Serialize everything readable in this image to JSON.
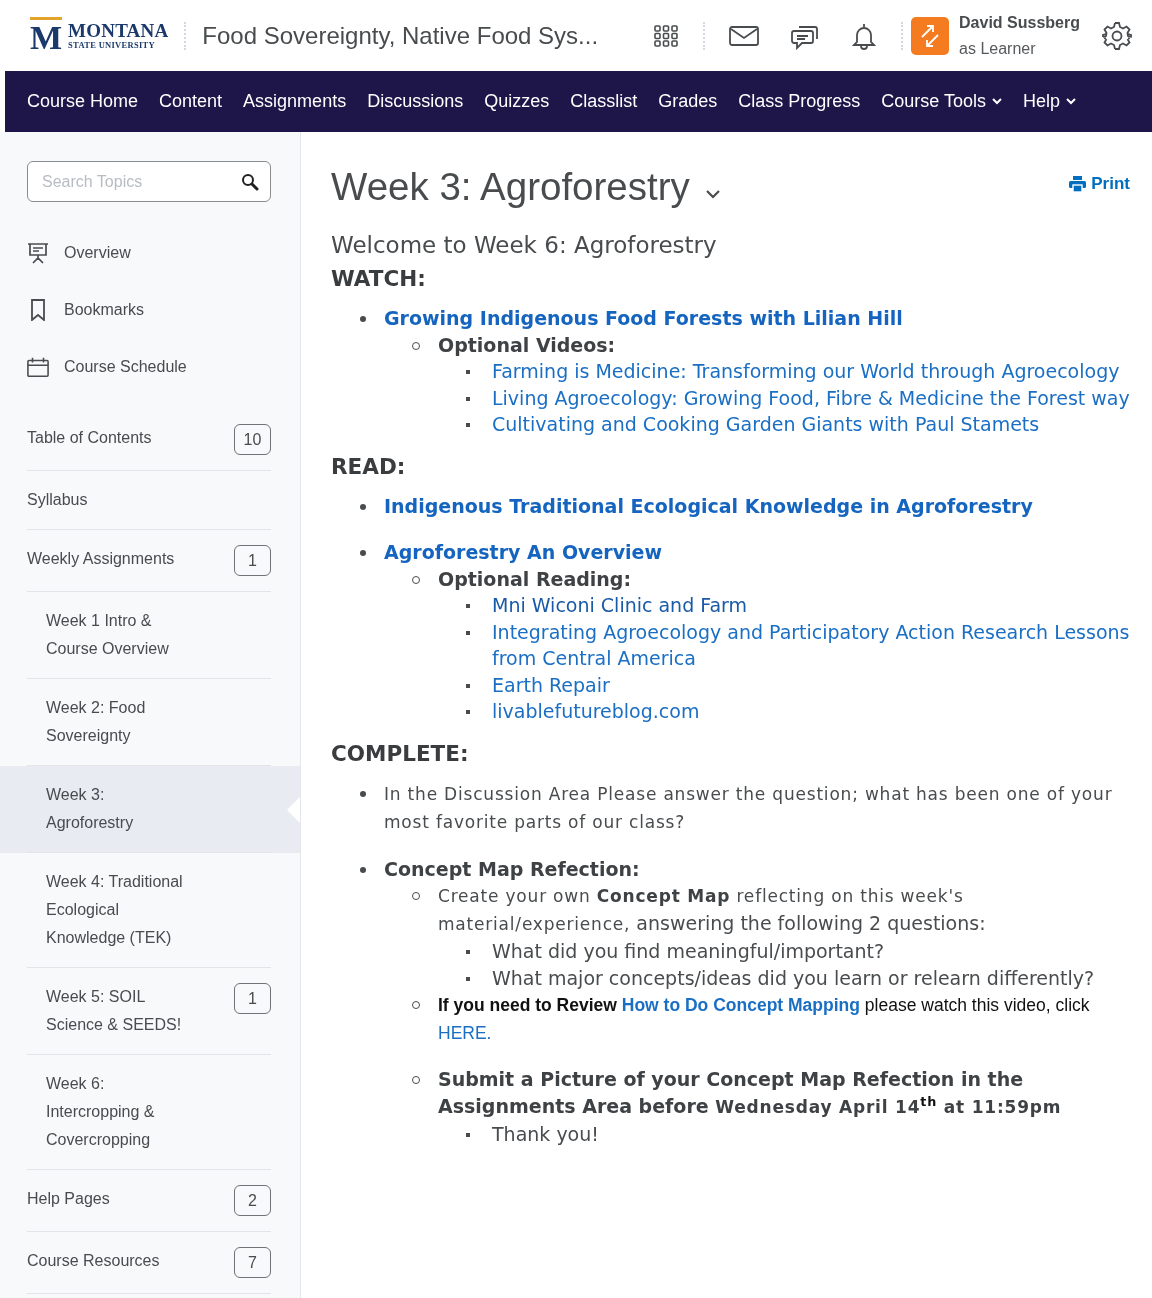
{
  "header": {
    "logo": {
      "mark": "M",
      "name": "MONTANA",
      "subtitle": "STATE UNIVERSITY"
    },
    "course_title": "Food Sovereignty, Native Food Sys...",
    "user": {
      "name": "David Sussberg",
      "role": "as Learner"
    }
  },
  "nav": {
    "items": [
      {
        "label": "Course Home",
        "dropdown": false
      },
      {
        "label": "Content",
        "dropdown": false
      },
      {
        "label": "Assignments",
        "dropdown": false
      },
      {
        "label": "Discussions",
        "dropdown": false
      },
      {
        "label": "Quizzes",
        "dropdown": false
      },
      {
        "label": "Classlist",
        "dropdown": false
      },
      {
        "label": "Grades",
        "dropdown": false
      },
      {
        "label": "Class Progress",
        "dropdown": false
      },
      {
        "label": "Course Tools",
        "dropdown": true
      },
      {
        "label": "Help",
        "dropdown": true
      }
    ]
  },
  "sidebar": {
    "search": {
      "placeholder": "Search Topics"
    },
    "tools": [
      {
        "label": "Overview",
        "kind": "overview"
      },
      {
        "label": "Bookmarks",
        "kind": "bookmarks"
      },
      {
        "label": "Course Schedule",
        "kind": "schedule"
      }
    ],
    "items": [
      {
        "label": "Table of Contents",
        "count": "10",
        "selected": false
      },
      {
        "label": "Syllabus",
        "selected": false
      },
      {
        "label": "Weekly Assignments",
        "count": "1",
        "selected": false,
        "children": [
          {
            "label": "Week 1 Intro & Course Overview",
            "selected": false
          },
          {
            "label": "Week 2: Food Sovereignty",
            "selected": false
          },
          {
            "label": "Week 3: Agroforestry",
            "selected": true
          },
          {
            "label": "Week 4: Traditional Ecological Knowledge (TEK)",
            "selected": false
          },
          {
            "label": "Week 5: SOIL Science & SEEDS!",
            "count": "1",
            "selected": false
          },
          {
            "label": "Week 6: Intercropping & Covercropping",
            "selected": false
          }
        ]
      },
      {
        "label": "Help Pages",
        "count": "2",
        "selected": false
      },
      {
        "label": "Course Resources",
        "count": "7",
        "selected": false
      }
    ]
  },
  "content": {
    "title": "Week 3: Agroforestry",
    "print_label": "Print",
    "intro": "Welcome to Week 6: Agroforestry",
    "sections": [
      {
        "heading": "WATCH:",
        "items": [
          {
            "parts": [
              {
                "text": "Growing Indigenous Food Forests with Lilian Hill",
                "kind": "link-bold"
              }
            ],
            "children": [
              {
                "parts": [
                  {
                    "text": "Optional Videos:",
                    "kind": "bold"
                  }
                ],
                "children": [
                  {
                    "parts": [
                      {
                        "text": "Farming is Medicine: Transforming our World through Agroecology",
                        "kind": "link"
                      }
                    ]
                  },
                  {
                    "parts": [
                      {
                        "text": "Living Agroecology: Growing Food, Fibre & Medicine the Forest way",
                        "kind": "link"
                      }
                    ]
                  },
                  {
                    "parts": [
                      {
                        "text": "Cultivating and Cooking Garden Giants with Paul Stamets",
                        "kind": "link"
                      }
                    ]
                  }
                ]
              }
            ]
          }
        ]
      },
      {
        "heading": "READ:",
        "items": [
          {
            "parts": [
              {
                "text": "Indigenous Traditional Ecological Knowledge in Agroforestry",
                "kind": "link-bold"
              }
            ]
          },
          {
            "parts": [
              {
                "text": "Agroforestry An Overview",
                "kind": "link-bold"
              }
            ],
            "children": [
              {
                "parts": [
                  {
                    "text": "Optional Reading:",
                    "kind": "bold"
                  }
                ],
                "children": [
                  {
                    "parts": [
                      {
                        "text": "Mni Wiconi Clinic and Farm",
                        "kind": "link-dark"
                      }
                    ]
                  },
                  {
                    "parts": [
                      {
                        "text": "Integrating Agroecology and Participatory Action Research Lessons from Central America",
                        "kind": "link"
                      }
                    ]
                  },
                  {
                    "parts": [
                      {
                        "text": "Earth Repair",
                        "kind": "link"
                      }
                    ]
                  },
                  {
                    "parts": [
                      {
                        "text": "livablefutureblog.com",
                        "kind": "link"
                      }
                    ]
                  }
                ]
              }
            ]
          }
        ]
      },
      {
        "heading": "COMPLETE:",
        "items": [
          {
            "parts": [
              {
                "text": "In the Discussion Area Please answer the question; what has been one of your most favorite parts of our class?",
                "kind": "small"
              }
            ]
          },
          {
            "parts": [
              {
                "text": "Concept Map Refection:",
                "kind": "bold"
              }
            ],
            "children": [
              {
                "parts": [
                  {
                    "text": "Create your own ",
                    "kind": "small"
                  },
                  {
                    "text": "Concept Map",
                    "kind": "bold-small"
                  },
                  {
                    "text": " reflecting on this week's material/experience,",
                    "kind": "small"
                  },
                  {
                    "text": " answering the following 2 questions:",
                    "kind": "plain"
                  }
                ],
                "children": [
                  {
                    "parts": [
                      {
                        "text": "What did you find meaningful/important?",
                        "kind": "plain"
                      }
                    ]
                  },
                  {
                    "parts": [
                      {
                        "text": "What major concepts/ideas did you learn or relearn differently?",
                        "kind": "plain"
                      }
                    ]
                  }
                ]
              },
              {
                "parts": [
                  {
                    "text": "If you need to Review ",
                    "kind": "sans-bold"
                  },
                  {
                    "text": "How to Do Concept Mapping",
                    "kind": "sans-link-bold"
                  },
                  {
                    "text": " please watch this video, click ",
                    "kind": "sans"
                  },
                  {
                    "text": "HERE.",
                    "kind": "sans-link"
                  }
                ]
              },
              {
                "parts": [
                  {
                    "text": "Submit a Picture of your Concept Map Refection in the Assignments Area before ",
                    "kind": "bold"
                  },
                  {
                    "text": "Wednesday April 14$^{th}$ at 11:59pm",
                    "kind": "bold-small"
                  }
                ],
                "children": [
                  {
                    "parts": [
                      {
                        "text": "Thank you!",
                        "kind": "plain"
                      }
                    ]
                  }
                ]
              }
            ]
          }
        ]
      }
    ]
  }
}
